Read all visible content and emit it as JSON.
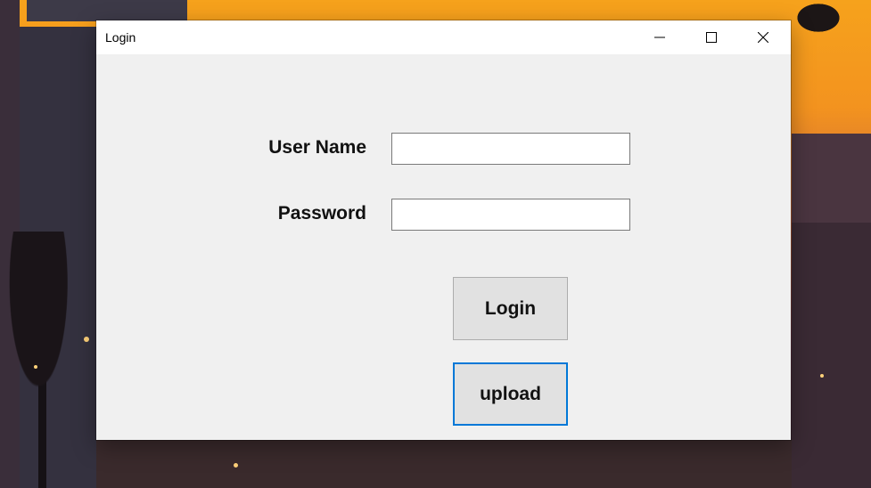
{
  "window": {
    "title": "Login",
    "controls": {
      "minimize_icon": "minimize-icon",
      "maximize_icon": "maximize-icon",
      "close_icon": "close-icon"
    }
  },
  "form": {
    "username_label": "User Name",
    "username_value": "",
    "password_label": "Password",
    "password_value": "",
    "login_button": "Login",
    "upload_button": "upload"
  },
  "colors": {
    "window_bg": "#f0f0f0",
    "titlebar_bg": "#ffffff",
    "button_bg": "#e1e1e1",
    "focus_border": "#0078d7"
  }
}
